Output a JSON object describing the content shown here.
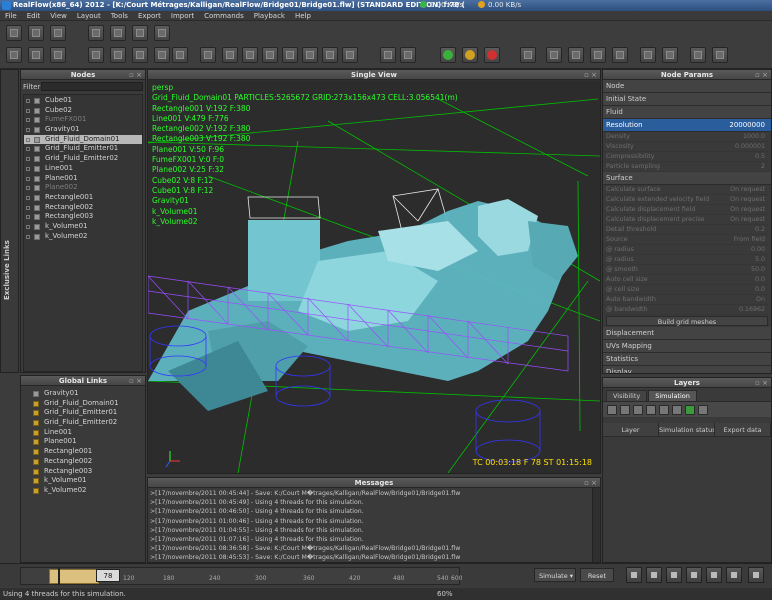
{
  "window": {
    "title": "RealFlow(x86_64) 2012 - [K:/Court Métrages/Kalligan/RealFlow/Bridge01/Bridge01.flw] (STANDARD EDITION) f:78 (",
    "net_in": "0.00 KB/s",
    "net_out": "0.00 KB/s"
  },
  "menu": [
    "File",
    "Edit",
    "View",
    "Layout",
    "Tools",
    "Export",
    "Import",
    "Commands",
    "Playback",
    "Help"
  ],
  "nodes_panel": {
    "title": "Nodes",
    "filter_label": "Filter",
    "items": [
      {
        "label": "Cube01",
        "state": "normal"
      },
      {
        "label": "Cube02",
        "state": "normal"
      },
      {
        "label": "FumeFX001",
        "state": "dim"
      },
      {
        "label": "Gravity01",
        "state": "normal"
      },
      {
        "label": "Grid_Fluid_Domain01",
        "state": "selected"
      },
      {
        "label": "Grid_Fluid_Emitter01",
        "state": "normal"
      },
      {
        "label": "Grid_Fluid_Emitter02",
        "state": "normal"
      },
      {
        "label": "Line001",
        "state": "normal"
      },
      {
        "label": "Plane001",
        "state": "normal"
      },
      {
        "label": "Plane002",
        "state": "dim"
      },
      {
        "label": "Rectangle001",
        "state": "normal"
      },
      {
        "label": "Rectangle002",
        "state": "normal"
      },
      {
        "label": "Rectangle003",
        "state": "normal"
      },
      {
        "label": "k_Volume01",
        "state": "normal"
      },
      {
        "label": "k_Volume02",
        "state": "normal"
      }
    ]
  },
  "exclusive_links": {
    "title": "Exclusive Links"
  },
  "global_links": {
    "title": "Global Links",
    "items": [
      "Gravity01",
      "Grid_Fluid_Domain01",
      "Grid_Fluid_Emitter01",
      "Grid_Fluid_Emitter02",
      "Line001",
      "Plane001",
      "Rectangle001",
      "Rectangle002",
      "Rectangle003",
      "k_Volume01",
      "k_Volume02"
    ]
  },
  "viewport": {
    "title": "Single View",
    "overlay_lines": [
      "persp",
      "Grid_Fluid_Domain01 PARTICLES:5265672 GRID:273x156x473 CELL:3.056541(m)",
      "Rectangle001 V:192 F:380",
      "Line001 V:479 F:776",
      "Rectangle002 V:192 F:380",
      "Rectangle003 V:192 F:380",
      "Plane001 V:50 F:96",
      "FumeFX001 V:0 F:0",
      "Plane002 V:25 F:32",
      "Cube02 V:8 F:12",
      "Cube01 V:8 F:12",
      "Gravity01",
      "k_Volume01",
      "k_Volume02"
    ],
    "timecode": "TC 00:03:18   F 78   ST 01:15:18"
  },
  "messages": {
    "title": "Messages",
    "lines": [
      ">[17/novembre/2011 00:45:44] - Save: K:/Court M�trages/Kalligan/RealFlow/Bridge01/Bridge01.flw",
      ">[17/novembre/2011 00:45:49] - Using 4 threads for this simulation.",
      ">[17/novembre/2011 00:46:50] - Using 4 threads for this simulation.",
      ">[17/novembre/2011 01:00:46] - Using 4 threads for this simulation.",
      ">[17/novembre/2011 01:04:55] - Using 4 threads for this simulation.",
      ">[17/novembre/2011 01:07:16] - Using 4 threads for this simulation.",
      ">[17/novembre/2011 08:36:58] - Save: K:/Court M�trages/Kalligan/RealFlow/Bridge01/Bridge01.flw",
      ">[17/novembre/2011 08:45:53] - Save: K:/Court M�trages/Kalligan/RealFlow/Bridge01/Bridge01.flw"
    ]
  },
  "params": {
    "title": "Node Params",
    "sections": [
      "Node",
      "Initial State",
      "Fluid"
    ],
    "resolution": {
      "label": "Resolution",
      "value": "20000000"
    },
    "fluid_rows": [
      {
        "label": "Density",
        "value": "1000.0"
      },
      {
        "label": "Viscosity",
        "value": "0.000001"
      },
      {
        "label": "Compressibility",
        "value": "0.5"
      },
      {
        "label": "Particle sampling",
        "value": "2"
      }
    ],
    "surface_label": "Surface",
    "surface_rows": [
      {
        "label": "Calculate surface",
        "value": "On request"
      },
      {
        "label": "Calculate extended velocity field",
        "value": "On request"
      },
      {
        "label": "Calculate displacement field",
        "value": "On request"
      },
      {
        "label": "Calculate displacement precise",
        "value": "On request"
      },
      {
        "label": "Detail threshold",
        "value": "0.2"
      },
      {
        "label": "Source",
        "value": "From field"
      },
      {
        "label": "@ radius",
        "value": "0.00"
      },
      {
        "label": "@ radius",
        "value": "5.0"
      },
      {
        "label": "@ smooth",
        "value": "50.0"
      },
      {
        "label": "Auto cell size",
        "value": "0.0"
      },
      {
        "label": "@ cell size",
        "value": "0.0"
      },
      {
        "label": "Auto bandwidth",
        "value": "On"
      },
      {
        "label": "@ bandwidth",
        "value": "0.16962"
      }
    ],
    "build_button": "Build grid meshes",
    "bottom_sections": [
      "Displacement",
      "UVs Mapping",
      "Statistics",
      "Display"
    ]
  },
  "layers": {
    "title": "Layers",
    "tabs": [
      "Visibility",
      "Simulation"
    ],
    "columns": [
      "Layer",
      "Simulation status",
      "Export data"
    ]
  },
  "timeline": {
    "ticks": [
      "0",
      "120",
      "180",
      "240",
      "300",
      "360",
      "420",
      "480",
      "540",
      "600"
    ],
    "current_frame": "78",
    "sim_mode": "Simulate",
    "reset_label": "Reset",
    "zoom": "60%",
    "play_range_fraction": 0.18
  },
  "status": {
    "text": "Using 4 threads for this simulation."
  },
  "colors": {
    "overlay_text": "#2bff2b",
    "timecode": "#ffe000",
    "fluid": "#6fc5d0",
    "wire_purple": "#9b4dff",
    "wire_blue": "#3535ff",
    "wire_green": "#00c000"
  }
}
